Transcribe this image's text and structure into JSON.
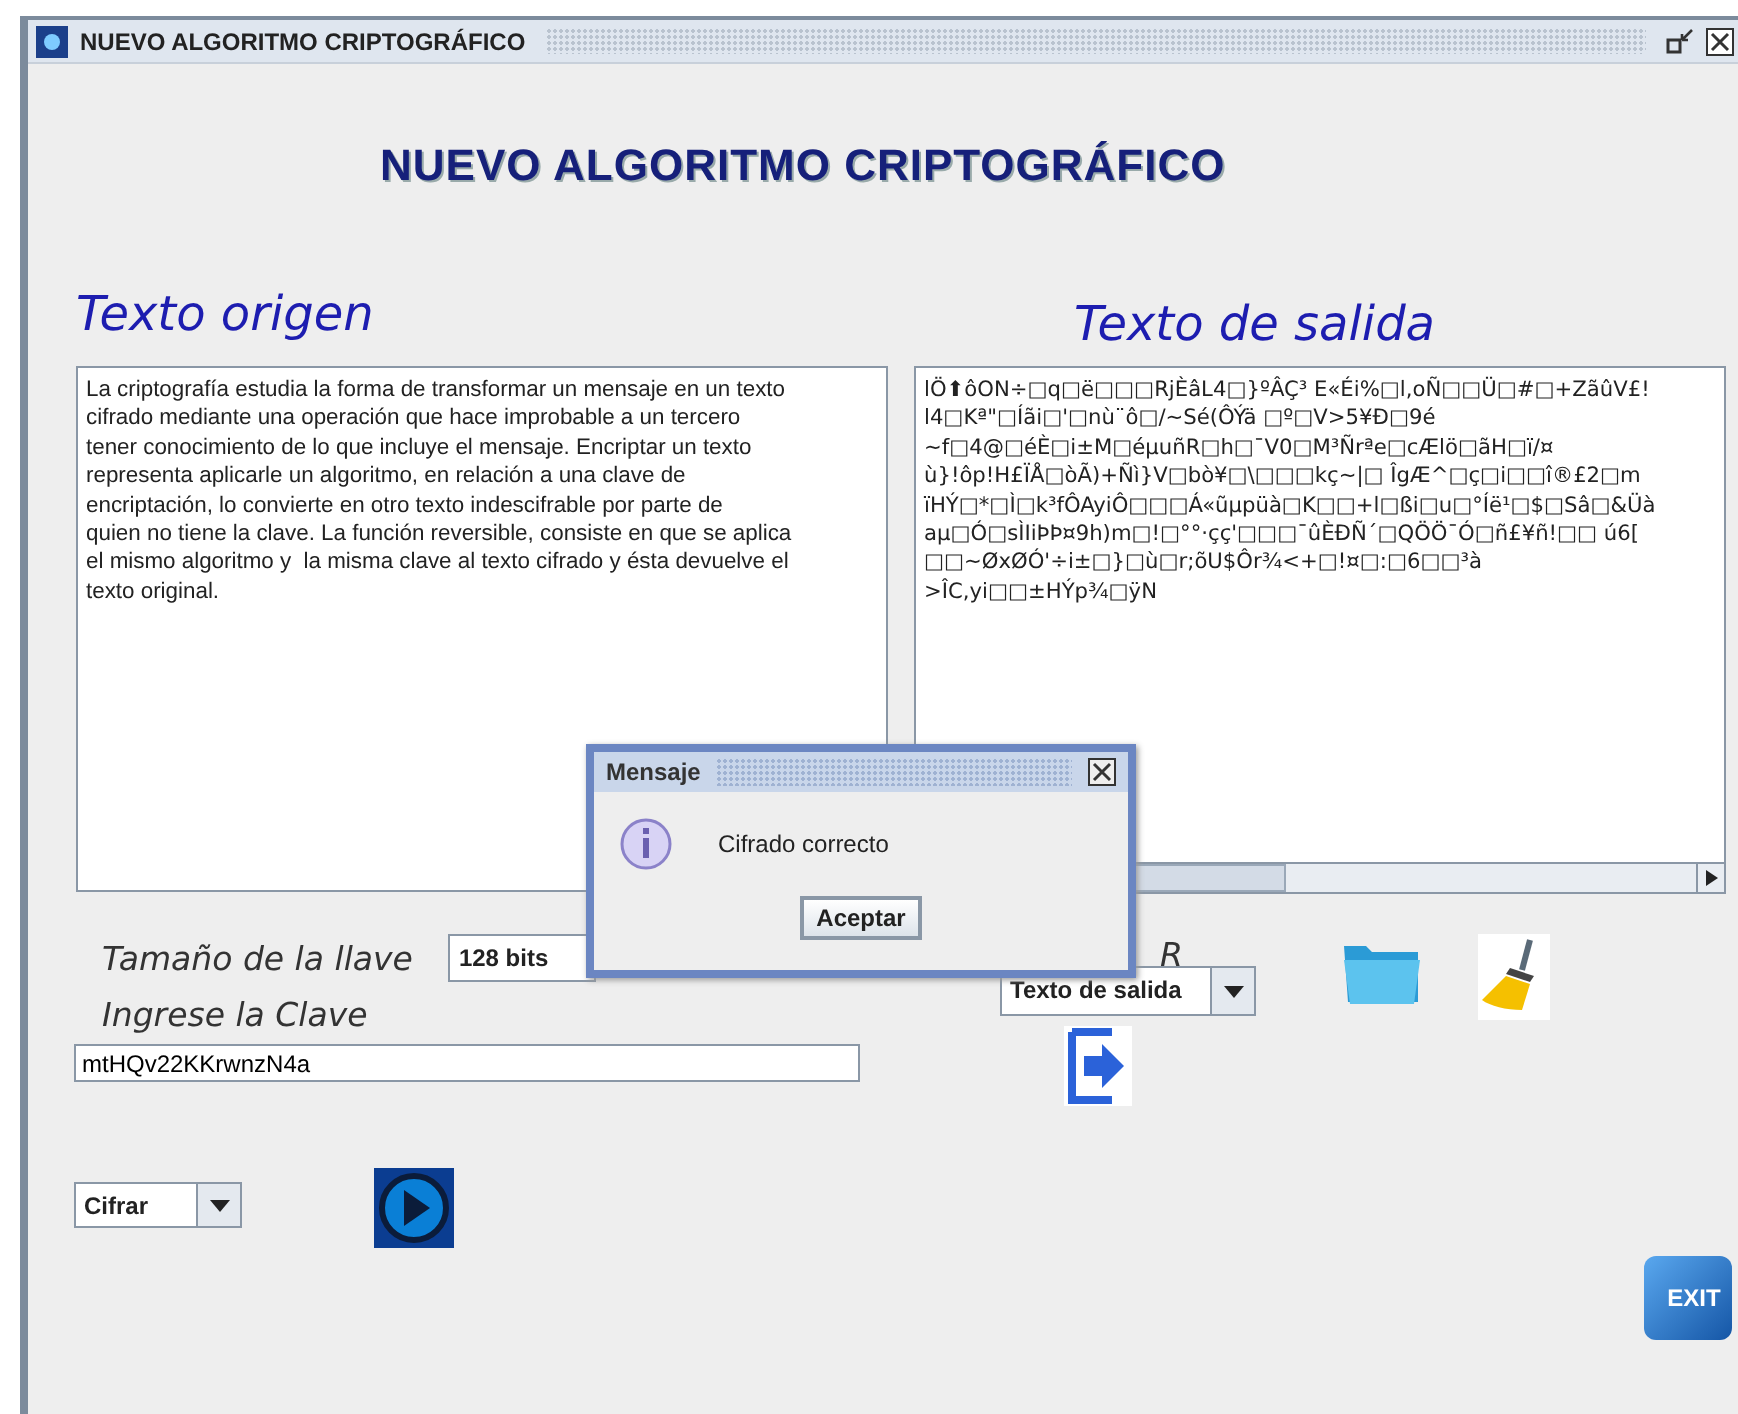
{
  "window": {
    "title": "NUEVO ALGORITMO CRIPTOGRÁFICO"
  },
  "heading": "NUEVO ALGORITMO CRIPTOGRÁFICO",
  "source": {
    "label": "Texto origen",
    "lines": [
      "La criptografía estudia la forma de transformar un mensaje en un texto",
      "cifrado mediante una operación que hace improbable a un tercero",
      "tener conocimiento de lo que incluye el mensaje. Encriptar un texto",
      "representa aplicarle un algoritmo, en relación a una clave de",
      "encriptación, lo convierte en otro texto indescifrable por parte de",
      "quien no tiene la clave. La función reversible, consiste en que se aplica",
      "el mismo algoritmo y  la misma clave al texto cifrado y ésta devuelve el",
      "texto original."
    ]
  },
  "output": {
    "label": "Texto de salida",
    "lines": [
      "lÖ⬆ôON÷□q□ë□□□RjÈâL4□}ºÂÇ³ E«Éi%□l,oÑ□□Ü□#□+ZãûV£!",
      "l4□Kª\"□Íãi□'□nù¨ô□/~Sé(ÔÝä □º□V>5¥Ð□9é",
      "~f□4@□éÈ□i±M□éµuñR□h□¯V0□M³Ñrªe□cÆlö□ãH□ï/¤",
      "ù}!ôp!H£ÏÅ□òÃ)+Ñì}V□bò¥□\\□□□kç~|□ ÎgÆ^□ç□i□□î®£2□m",
      "ïHÝ□*□Ì□k³fÔAyiÔ□□□Á«ũµpüà□K□□+l□ßi□u□°Íë¹□$□Sâ□&Üà",
      "aµ□Ó□sÌIiÞÞ¤9h)m□!□°°·çç'□□□¯ûÈÐÑ´□QÖÖ¯Ó□ñ£¥ñ!□□ ú6[",
      "□□~ØxØÓ'÷i±□}□ù□r;õU$Ôr¾<+□!¤□:□6□□³à",
      ">ÎC,yi□□±HÝp¾□ÿN"
    ]
  },
  "key_size": {
    "label": "Tamaño de la llave",
    "value": "128 bits"
  },
  "key": {
    "label": "Ingrese la Clave",
    "value": "mtHQv22KKrwnzN4a"
  },
  "operation": {
    "value": "Cifrar"
  },
  "target": {
    "label": "R",
    "value": "Texto de salida"
  },
  "exit_button": {
    "label": "EXIT"
  },
  "dialog": {
    "title": "Mensaje",
    "message": "Cifrado correcto",
    "button": "Aceptar"
  }
}
